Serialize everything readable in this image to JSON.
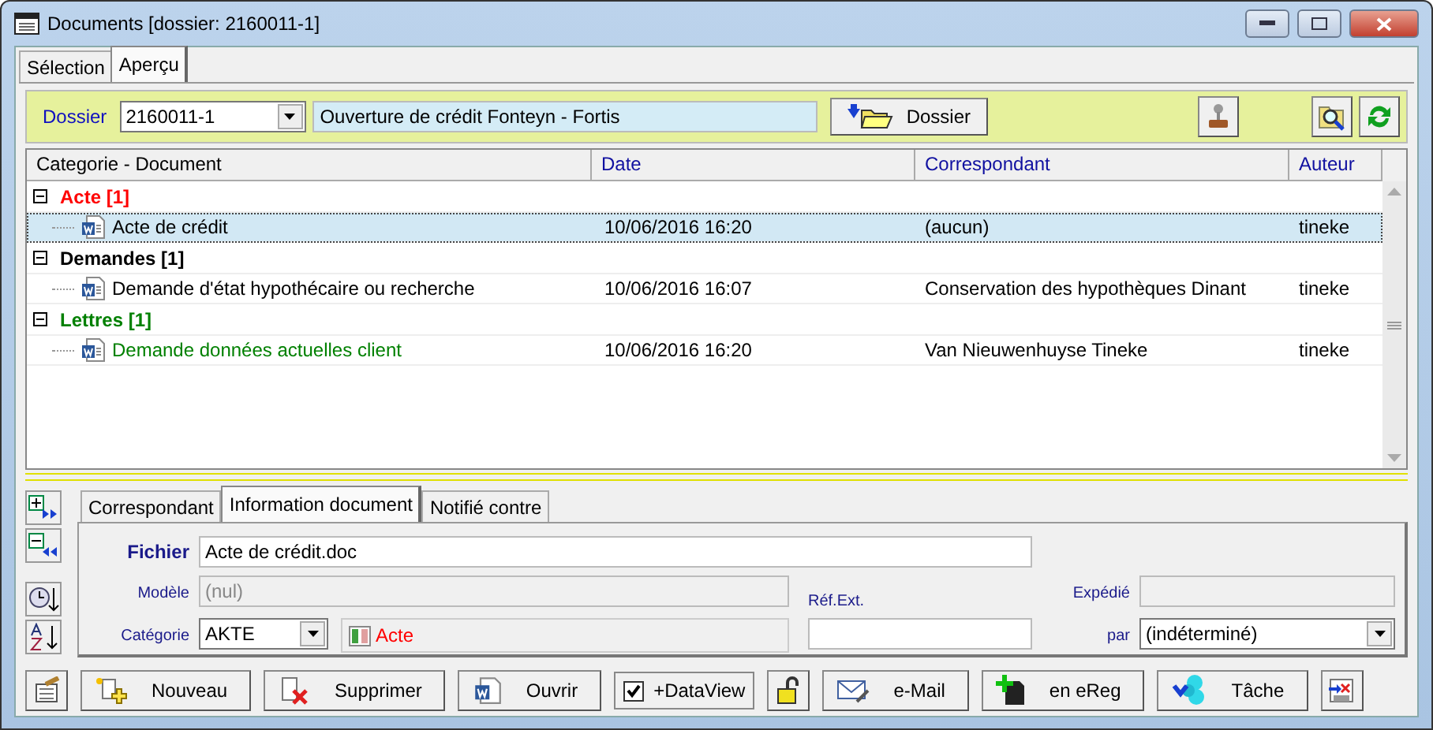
{
  "window": {
    "title": "Documents  [dossier: 2160011-1]"
  },
  "tabs": [
    {
      "label": "Sélection",
      "selected": false
    },
    {
      "label": "Aperçu",
      "selected": true
    }
  ],
  "toolbar": {
    "dossier_label": "Dossier",
    "dossier_value": "2160011-1",
    "description": "Ouverture de crédit Fonteyn - Fortis",
    "dossier_button": "Dossier"
  },
  "table": {
    "columns": [
      "Categorie - Document",
      "Date",
      "Correspondant",
      "Auteur"
    ],
    "groups": [
      {
        "label": "Acte [1]",
        "color": "#ff0000",
        "expanded": true,
        "documents": [
          {
            "name": "Acte de crédit",
            "date": "10/06/2016 16:20",
            "correspondant": "(aucun)",
            "auteur": "tineke",
            "color": "#000000",
            "selected": true
          }
        ]
      },
      {
        "label": "Demandes [1]",
        "color": "#000000",
        "expanded": true,
        "documents": [
          {
            "name": "Demande d'état hypothécaire ou recherche",
            "date": "10/06/2016 16:07",
            "correspondant": "Conservation des hypothèques Dinant",
            "auteur": "tineke",
            "color": "#000000",
            "selected": false
          }
        ]
      },
      {
        "label": "Lettres [1]",
        "color": "#008000",
        "expanded": true,
        "documents": [
          {
            "name": "Demande données actuelles client",
            "date": "10/06/2016 16:20",
            "correspondant": "Van Nieuwenhuyse Tineke",
            "auteur": "tineke",
            "color": "#008000",
            "selected": false
          }
        ]
      }
    ]
  },
  "detail_tabs": [
    {
      "label": "Correspondant",
      "selected": false
    },
    {
      "label": "Information document",
      "selected": true
    },
    {
      "label": "Notifié contre",
      "selected": false
    }
  ],
  "form": {
    "fichier": {
      "label": "Fichier",
      "value": "Acte de crédit.doc"
    },
    "modele": {
      "label": "Modèle",
      "value": "(nul)",
      "disabled": true
    },
    "categorie": {
      "label": "Catégorie",
      "value": "AKTE",
      "display": "Acte"
    },
    "ref_ext": {
      "label": "Réf.Ext."
    },
    "expedie": {
      "label": "Expédié",
      "disabled": true
    },
    "par": {
      "label": "par",
      "value": "(indéterminé)"
    }
  },
  "buttons": [
    {
      "kind": "icon"
    },
    {
      "kind": "button",
      "label": "Nouveau"
    },
    {
      "kind": "button",
      "label": "Supprimer"
    },
    {
      "kind": "button",
      "label": "Ouvrir"
    },
    {
      "kind": "check",
      "label": "+DataView",
      "checked": true
    },
    {
      "kind": "icon"
    },
    {
      "kind": "button",
      "label": "e-Mail"
    },
    {
      "kind": "button",
      "label": "en eReg"
    },
    {
      "kind": "button",
      "label": "Tâche"
    },
    {
      "kind": "icon"
    }
  ]
}
